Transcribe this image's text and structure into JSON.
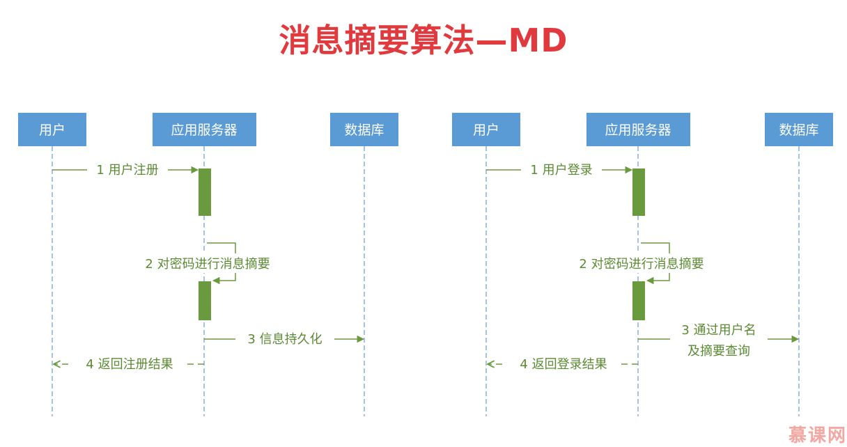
{
  "title": "消息摘要算法—MD",
  "watermark": "慕课网",
  "colors": {
    "title": "#e0393e",
    "actor_box": "#5b9bd5",
    "lifeline": "#7fa7d8",
    "activation": "#6a9a3e",
    "message": "#5a8a32"
  },
  "diagrams": [
    {
      "name": "register",
      "actors": [
        "用户",
        "应用服务器",
        "数据库"
      ],
      "messages": {
        "m1": "1 用户注册",
        "m2": "2 对密码进行消息摘要",
        "m3": "3 信息持久化",
        "m4": "4 返回注册结果"
      }
    },
    {
      "name": "login",
      "actors": [
        "用户",
        "应用服务器",
        "数据库"
      ],
      "messages": {
        "m1": "1 用户登录",
        "m2": "2 对密码进行消息摘要",
        "m3_line1": "3 通过用户名",
        "m3_line2": "及摘要查询",
        "m4": "4 返回登录结果"
      }
    }
  ]
}
